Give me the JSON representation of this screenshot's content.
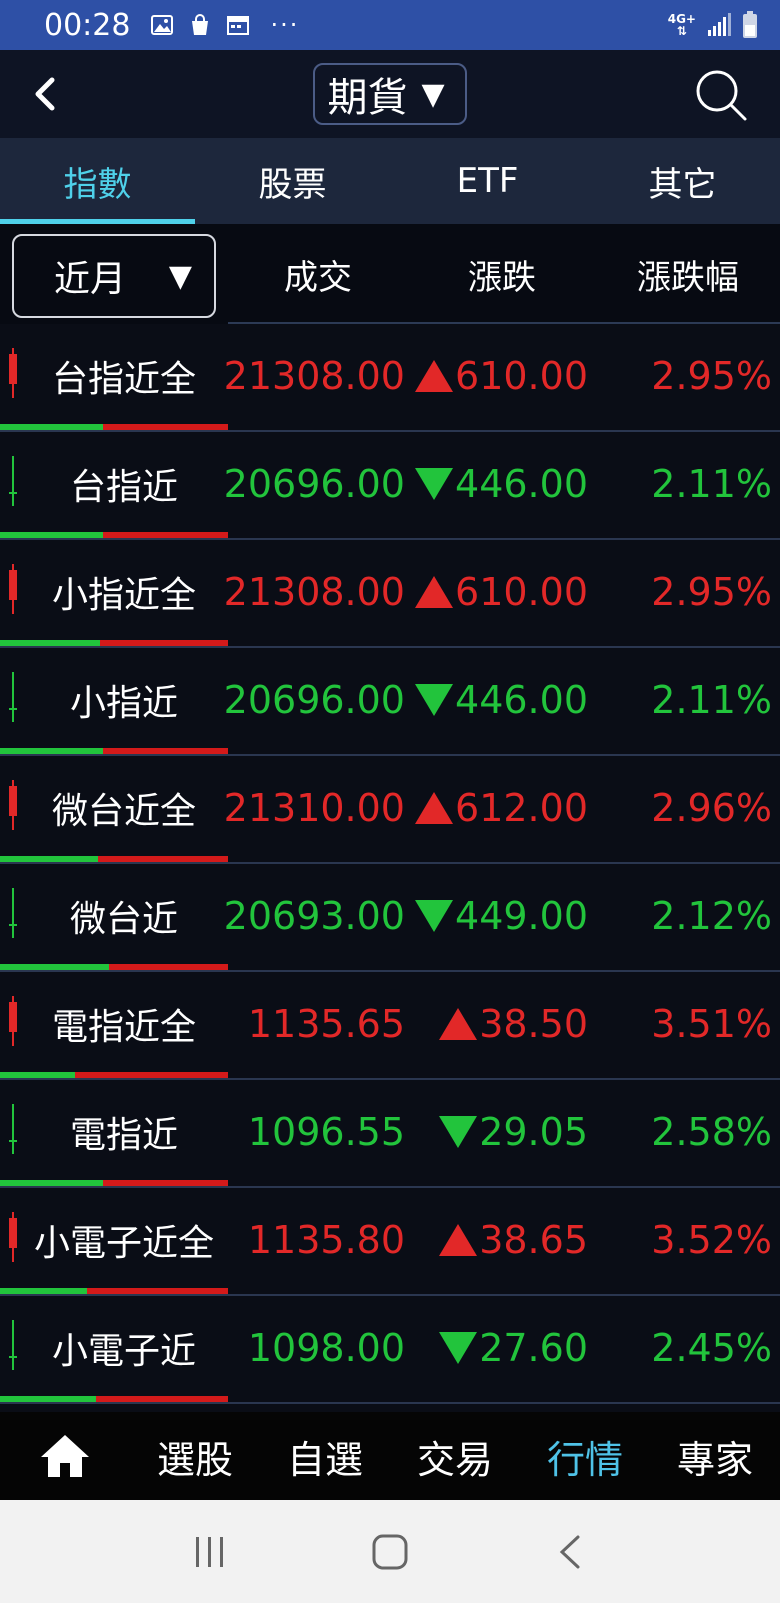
{
  "status_bar": {
    "time": "00:28",
    "network": "4G+"
  },
  "header": {
    "title": "期貨",
    "dropdown_caret": "▼"
  },
  "tabs": [
    {
      "label": "指數",
      "active": true
    },
    {
      "label": "股票",
      "active": false
    },
    {
      "label": "ETF",
      "active": false
    },
    {
      "label": "其它",
      "active": false
    }
  ],
  "columns": {
    "month_selector": "近月",
    "caret": "▼",
    "price": "成交",
    "change": "漲跌",
    "pct": "漲跌幅"
  },
  "rows": [
    {
      "name": "台指近全",
      "price": "21308.00",
      "change": "610.00",
      "pct": "2.95%",
      "direction": "up",
      "green_fraction": 0.45
    },
    {
      "name": "台指近",
      "price": "20696.00",
      "change": "446.00",
      "pct": "2.11%",
      "direction": "down",
      "green_fraction": 0.45
    },
    {
      "name": "小指近全",
      "price": "21308.00",
      "change": "610.00",
      "pct": "2.95%",
      "direction": "up",
      "green_fraction": 0.44
    },
    {
      "name": "小指近",
      "price": "20696.00",
      "change": "446.00",
      "pct": "2.11%",
      "direction": "down",
      "green_fraction": 0.45
    },
    {
      "name": "微台近全",
      "price": "21310.00",
      "change": "612.00",
      "pct": "2.96%",
      "direction": "up",
      "green_fraction": 0.43
    },
    {
      "name": "微台近",
      "price": "20693.00",
      "change": "449.00",
      "pct": "2.12%",
      "direction": "down",
      "green_fraction": 0.48
    },
    {
      "name": "電指近全",
      "price": "1135.65",
      "change": "38.50",
      "pct": "3.51%",
      "direction": "up",
      "green_fraction": 0.33
    },
    {
      "name": "電指近",
      "price": "1096.55",
      "change": "29.05",
      "pct": "2.58%",
      "direction": "down",
      "green_fraction": 0.45
    },
    {
      "name": "小電子近全",
      "price": "1135.80",
      "change": "38.65",
      "pct": "3.52%",
      "direction": "up",
      "green_fraction": 0.38
    },
    {
      "name": "小電子近",
      "price": "1098.00",
      "change": "27.60",
      "pct": "2.45%",
      "direction": "down",
      "green_fraction": 0.42
    }
  ],
  "bottom_nav": [
    {
      "label": "",
      "icon": "home-icon"
    },
    {
      "label": "選股"
    },
    {
      "label": "自選"
    },
    {
      "label": "交易"
    },
    {
      "label": "行情",
      "active": true
    },
    {
      "label": "專家"
    }
  ],
  "colors": {
    "up": "#e22828",
    "down": "#22c43c",
    "accent": "#4fd1ea",
    "statusbar": "#2e50a6"
  }
}
